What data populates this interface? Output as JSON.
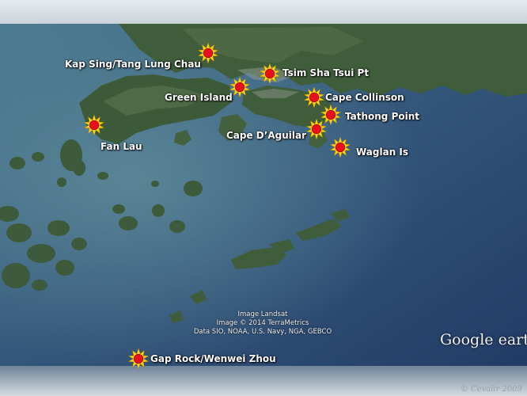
{
  "map": {
    "locations": [
      {
        "name": "Kap Sing/Tang Lung Chau"
      },
      {
        "name": "Tsim Sha Tsui Pt"
      },
      {
        "name": "Green Island"
      },
      {
        "name": "Cape Collinson"
      },
      {
        "name": "Tathong Point"
      },
      {
        "name": "Fan Lau"
      },
      {
        "name": "Cape D’Aguilar"
      },
      {
        "name": "Waglan Is"
      },
      {
        "name": "Gap Rock/Wenwei Zhou"
      }
    ],
    "credits": {
      "line1": "Image Landsat",
      "line2": "Image © 2014 TerraMetrics",
      "line3": "Data SIO, NOAA, U.S. Navy, NGA, GEBCO"
    },
    "logo_text": "Google earth",
    "signature": "© Cevalir 2009",
    "colors": {
      "marker_fill": "#e8101a",
      "marker_rays": "#ffd21a",
      "sea_deep": "#27426e",
      "sea_shallow": "#4d7a93",
      "land": "#3c5a3a"
    }
  }
}
